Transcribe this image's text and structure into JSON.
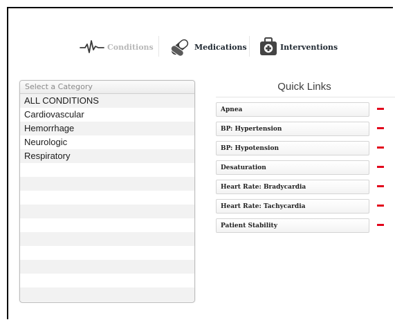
{
  "tabs": [
    {
      "label": "Conditions",
      "icon": "heartbeat-icon",
      "active": true
    },
    {
      "label": "Medications",
      "icon": "pills-icon",
      "active": false
    },
    {
      "label": "Interventions",
      "icon": "medical-kit-icon",
      "active": false
    }
  ],
  "category_panel": {
    "header": "Select a Category",
    "items": [
      "ALL CONDITIONS",
      "Cardiovascular",
      "Hemorrhage",
      "Neurologic",
      "Respiratory",
      "",
      "",
      "",
      "",
      "",
      "",
      "",
      "",
      "",
      ""
    ]
  },
  "quick_links": {
    "title": "Quick Links",
    "items": [
      "Apnea",
      "BP: Hypertension",
      "BP: Hypotension",
      "Desaturation",
      "Heart Rate: Bradycardia",
      "Heart Rate: Tachycardia",
      "Patient Stability"
    ],
    "remove_icon": "minus-icon",
    "remove_color": "#e2001a"
  }
}
